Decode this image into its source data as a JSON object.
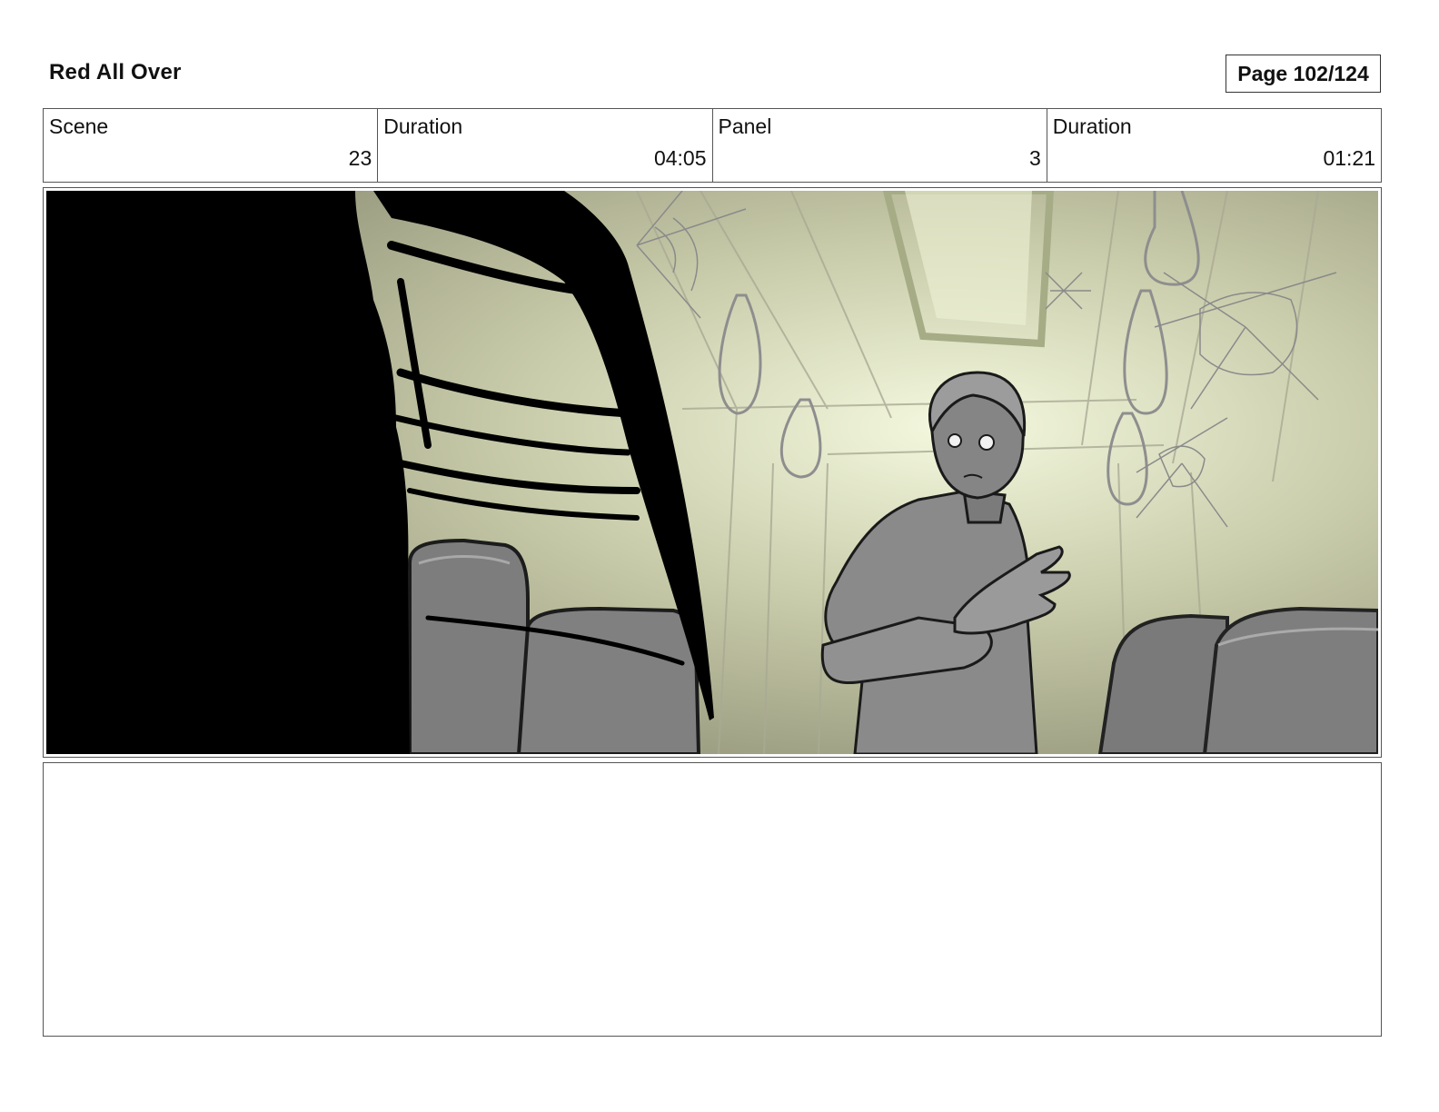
{
  "document": {
    "title": "Red All Over",
    "page_label": "Page 102/124"
  },
  "info": [
    {
      "label": "Scene",
      "value": "23"
    },
    {
      "label": "Duration",
      "value": "04:05"
    },
    {
      "label": "Panel",
      "value": "3"
    },
    {
      "label": "Duration",
      "value": "01:21"
    }
  ],
  "colors": {
    "panel_light": "#f4f8de",
    "panel_mid": "#c9ccaa",
    "panel_dark": "#8c8d74",
    "silhouette": "#000000",
    "seat_gray": "#7d7d7d",
    "figure_gray": "#8a8a8a"
  },
  "notes": ""
}
